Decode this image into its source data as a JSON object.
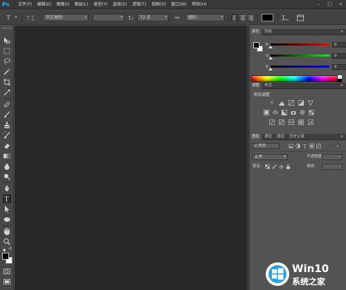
{
  "app": {
    "logo_text": "Ps"
  },
  "menu": [
    "文件(F)",
    "编辑(E)",
    "图像(I)",
    "图层(L)",
    "类型(Y)",
    "选择(S)",
    "滤镜(T)",
    "视图(V)",
    "窗口(W)",
    "帮助(H)"
  ],
  "window_controls": {
    "minimize": "–",
    "maximize": "□",
    "close": "×"
  },
  "options_bar": {
    "type_tool_glyph": "T",
    "font_family": "华文琥珀",
    "font_style": "-",
    "font_size": "72 点",
    "aa_label": "aa",
    "anti_alias": "锐利",
    "text_color": "#000000"
  },
  "toolbar": {
    "active_tool": "horizontal-type-tool",
    "foreground_color": "#000000",
    "background_color": "#ffffff"
  },
  "color_panel": {
    "tabs": [
      "颜色",
      "色板"
    ],
    "channels": [
      {
        "label": "R",
        "value": "0",
        "gradient_end": "#ff0000"
      },
      {
        "label": "G",
        "value": "0",
        "gradient_end": "#00ff00"
      },
      {
        "label": "B",
        "value": "0",
        "gradient_end": "#0000ff"
      }
    ]
  },
  "adjustments_panel": {
    "tabs": [
      "调整",
      "样式"
    ],
    "heading": "添加调整"
  },
  "layers_panel": {
    "tabs": [
      "图层",
      "通道",
      "路径",
      "历史记录"
    ],
    "filter_kind": "ρ 类型",
    "blend_mode": "正常",
    "opacity_label": "不透明度:",
    "lock_label": "锁定:",
    "fill_label": "填充:"
  },
  "watermark": {
    "line1": "Win10",
    "line2": "系统之家"
  }
}
